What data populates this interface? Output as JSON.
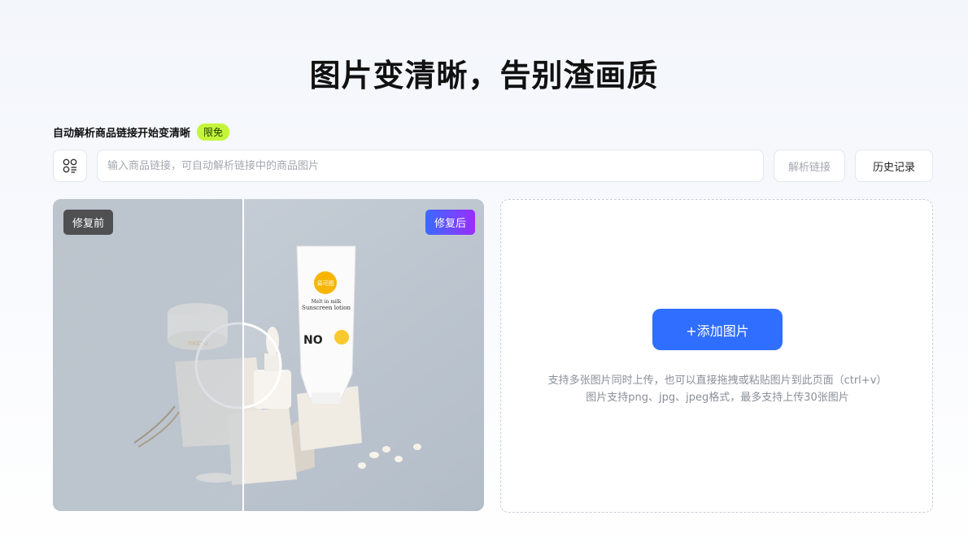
{
  "header": {
    "title": "图片变清晰，告别渣画质"
  },
  "link_section": {
    "label": "自动解析商品链接开始变清晰",
    "badge": "限免",
    "input_placeholder": "输入商品链接，可自动解析链接中的商品图片",
    "parse_button": "解析链接",
    "history_button": "历史记录",
    "scan_icon": "apps-scan-icon"
  },
  "compare": {
    "before_label": "修复前",
    "after_label": "修复后",
    "product_logo": "易可图",
    "product_text_line1": "Melt in milk",
    "product_text_line2": "Sunscreen lotion",
    "product_badge": "NO",
    "jar_label": "YIKETU"
  },
  "upload": {
    "add_button": "+添加图片",
    "hint_line1": "支持多张图片同时上传，也可以直接拖拽或粘贴图片到此页面（ctrl+v）",
    "hint_line2": "图片支持png、jpg、jpeg格式，最多支持上传30张图片"
  },
  "colors": {
    "primary": "#2f6eff",
    "badge": "#c4f53a",
    "after_tag_start": "#3a6bff",
    "after_tag_end": "#9a2dff"
  }
}
